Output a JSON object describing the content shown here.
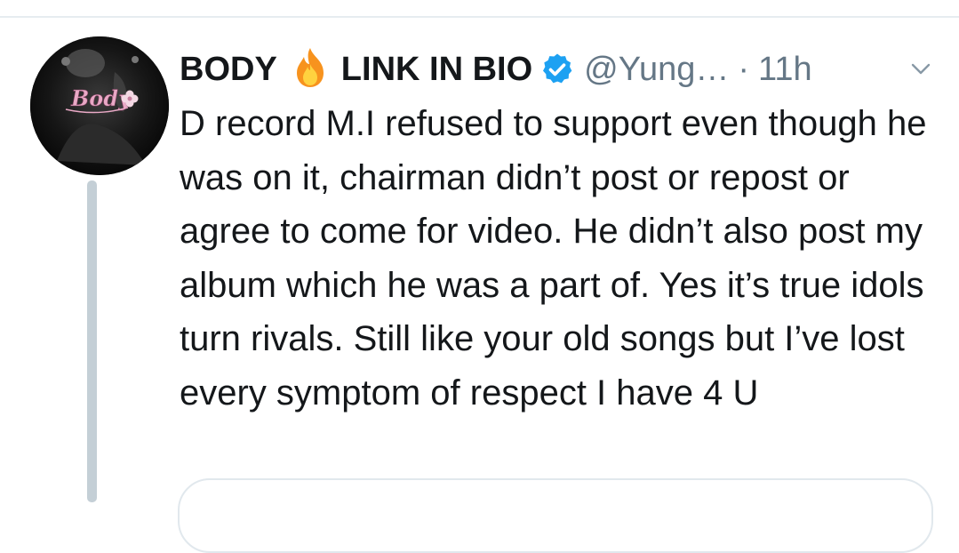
{
  "tweet": {
    "display_name_left": "BODY",
    "display_name_right": "LINK IN BIO",
    "handle": "@Yung…",
    "separator": "·",
    "time": "11h",
    "avatar_text": "Body",
    "text": "D record M.I refused to support even though he was on it, chairman didn’t post or repost or agree to come for video. He didn’t also post my album which he was a part of. Yes it’s true idols turn rivals. Still like your old songs but I’ve lost every symptom of respect I have 4 U"
  },
  "icons": {
    "name_emoji": "fire-icon",
    "badge": "verified-badge-icon",
    "menu": "chevron-down-icon"
  },
  "colors": {
    "text": "#14171a",
    "secondary": "#657786",
    "verified": "#1da1f2",
    "thread_line": "#c4cfd6",
    "divider": "#e6ecf0"
  }
}
